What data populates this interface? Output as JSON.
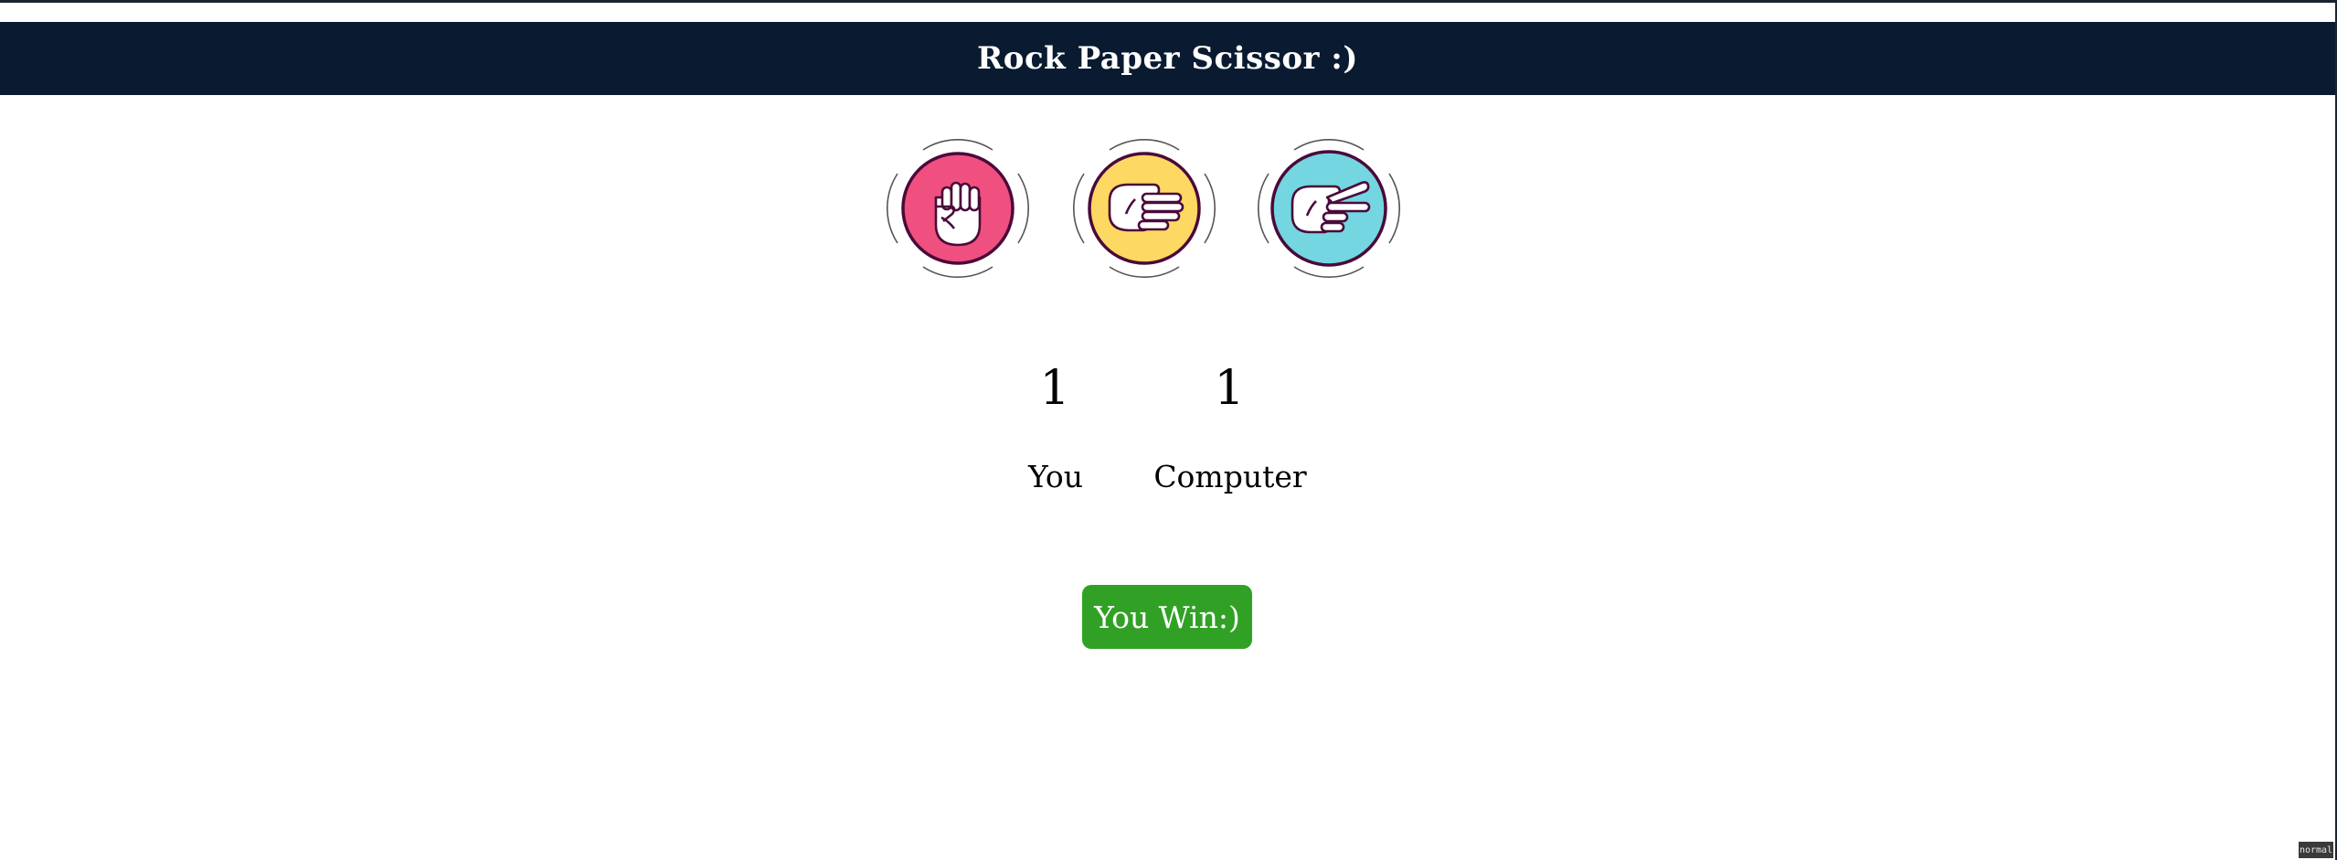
{
  "header": {
    "title": "Rock Paper Scissor :)"
  },
  "choices": [
    {
      "name": "rock",
      "icon": "rock-fist-icon",
      "color": "#f0507f"
    },
    {
      "name": "paper",
      "icon": "paper-hand-icon",
      "color": "#fdd862"
    },
    {
      "name": "scissor",
      "icon": "scissor-hand-icon",
      "color": "#73d6e0"
    }
  ],
  "scoreboard": {
    "user_score": "1",
    "computer_score": "1",
    "user_label": "You",
    "computer_label": "Computer"
  },
  "result": {
    "message": "You Win:)",
    "color": "#31a125"
  },
  "status": {
    "mode": "normal"
  }
}
